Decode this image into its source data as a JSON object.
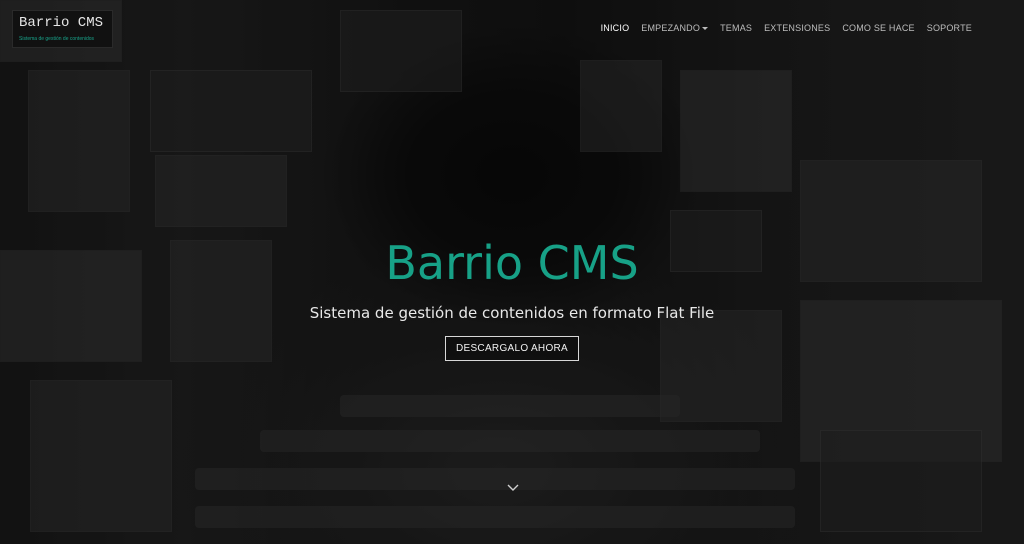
{
  "logo": {
    "title": "Barrio CMS",
    "subtitle": "Sistema de gestión de contenidos"
  },
  "nav": {
    "items": [
      {
        "label": "INICIO",
        "active": true
      },
      {
        "label": "EMPEZANDO",
        "dropdown": true
      },
      {
        "label": "TEMAS"
      },
      {
        "label": "EXTENSIONES"
      },
      {
        "label": "COMO SE HACE"
      },
      {
        "label": "SOPORTE"
      }
    ]
  },
  "hero": {
    "title": "Barrio CMS",
    "subtitle": "Sistema de gestión de contenidos en formato Flat File",
    "cta_label": "DESCARGALO AHORA"
  },
  "icons": {
    "scroll": "chevron-down-icon",
    "nav_caret": "caret-down-icon"
  },
  "colors": {
    "accent": "#17a187",
    "nav_text": "#bdbdbd",
    "nav_active": "#ffffff",
    "background": "#171717"
  }
}
